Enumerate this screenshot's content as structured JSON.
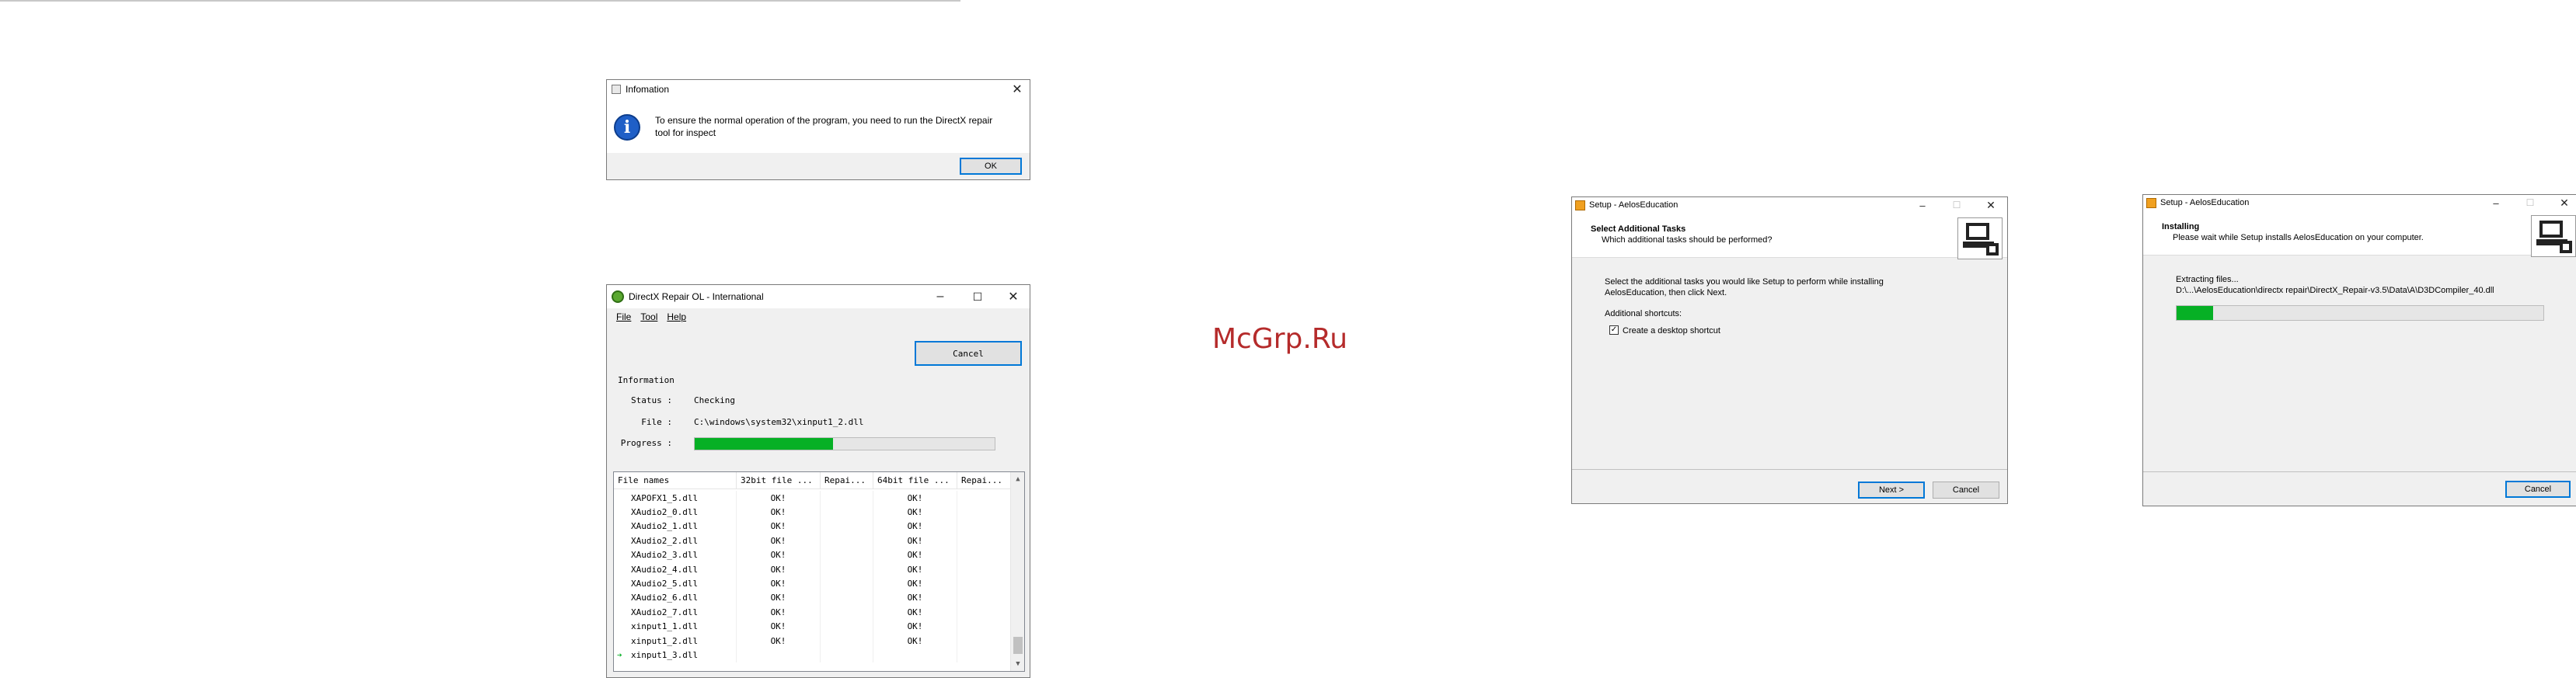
{
  "info_dialog": {
    "title": "Infomation",
    "message": "To ensure the normal operation of the program, you need to run the DirectX repair tool for inspect",
    "ok_label": "OK"
  },
  "directx_repair": {
    "title": "DirectX Repair OL - International",
    "menu": [
      "File",
      "Tool",
      "Help"
    ],
    "cancel_label": "Cancel",
    "section_label": "Information",
    "status_label": "Status :",
    "status_value": "Checking",
    "file_label": "File :",
    "file_value": "C:\\windows\\system32\\xinput1_2.dll",
    "progress_label": "Progress :",
    "progress_fraction": 0.46,
    "columns": [
      "File names",
      "32bit file ...",
      "Repai...",
      "64bit file ...",
      "Repai..."
    ],
    "rows": [
      {
        "name": "XAPOFX1_5.dll",
        "b32": "OK!",
        "b64": "OK!"
      },
      {
        "name": "XAudio2_0.dll",
        "b32": "OK!",
        "b64": "OK!"
      },
      {
        "name": "XAudio2_1.dll",
        "b32": "OK!",
        "b64": "OK!"
      },
      {
        "name": "XAudio2_2.dll",
        "b32": "OK!",
        "b64": "OK!"
      },
      {
        "name": "XAudio2_3.dll",
        "b32": "OK!",
        "b64": "OK!"
      },
      {
        "name": "XAudio2_4.dll",
        "b32": "OK!",
        "b64": "OK!"
      },
      {
        "name": "XAudio2_5.dll",
        "b32": "OK!",
        "b64": "OK!"
      },
      {
        "name": "XAudio2_6.dll",
        "b32": "OK!",
        "b64": "OK!"
      },
      {
        "name": "XAudio2_7.dll",
        "b32": "OK!",
        "b64": "OK!"
      },
      {
        "name": "xinput1_1.dll",
        "b32": "OK!",
        "b64": "OK!"
      },
      {
        "name": "xinput1_2.dll",
        "b32": "OK!",
        "b64": "OK!"
      },
      {
        "name": "xinput1_3.dll",
        "b32": "",
        "b64": "",
        "current": true
      }
    ]
  },
  "watermark": "McGrp.Ru",
  "setup_tasks": {
    "title": "Setup - AelosEducation",
    "header_title": "Select Additional Tasks",
    "header_subtitle": "Which additional tasks should be performed?",
    "body_line1": "Select the additional tasks you would like Setup to perform while installing",
    "body_line2": "AelosEducation, then click Next.",
    "shortcuts_label": "Additional shortcuts:",
    "checkbox_label": "Create a desktop shortcut",
    "checkbox_checked": true,
    "next_label": "Next >",
    "cancel_label": "Cancel"
  },
  "setup_installing": {
    "title": "Setup - AelosEducation",
    "header_title": "Installing",
    "header_subtitle": "Please wait while Setup installs AelosEducation on your computer.",
    "extracting_label": "Extracting files...",
    "extracting_path": "D:\\...\\AelosEducation\\directx repair\\DirectX_Repair-v3.5\\Data\\A\\D3DCompiler_40.dll",
    "progress_fraction": 0.1,
    "cancel_label": "Cancel"
  },
  "colors": {
    "progress_green": "#06b025",
    "focus_blue": "#0078d7",
    "watermark_red": "#b52b2b"
  }
}
